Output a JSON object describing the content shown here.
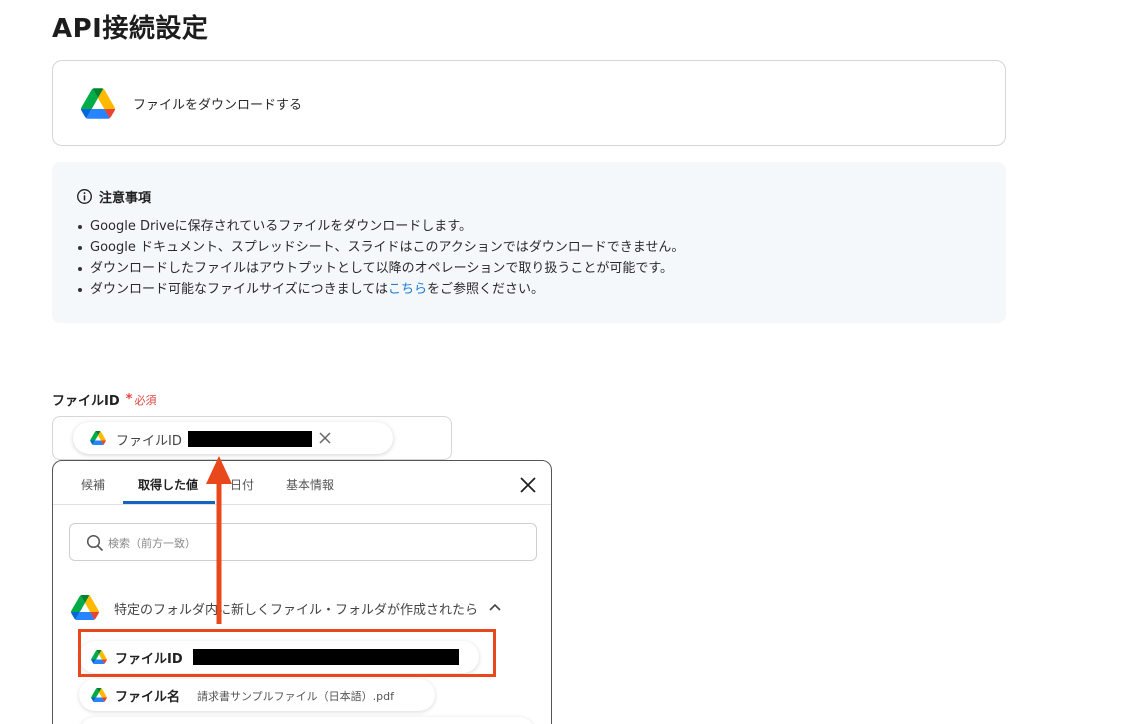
{
  "page_title": "API接続設定",
  "action": {
    "label": "ファイルをダウンロードする",
    "icon": "google-drive-icon"
  },
  "notice": {
    "title": "注意事項",
    "items": [
      "Google Driveに保存されているファイルをダウンロードします。",
      "Google ドキュメント、スプレッドシート、スライドはこのアクションではダウンロードできません。",
      "ダウンロードしたファイルはアウトプットとして以降のオペレーションで取り扱うことが可能です。"
    ],
    "last_item": {
      "before": "ダウンロード可能なファイルサイズにつきましては",
      "link": "こちら",
      "after": "をご参照ください。"
    }
  },
  "field": {
    "label": "ファイルID",
    "asterisk": "*",
    "required": "必須",
    "chip_label": "ファイルID"
  },
  "popover": {
    "tabs": [
      "候補",
      "取得した値",
      "日付",
      "基本情報"
    ],
    "active_tab": "取得した値",
    "search_placeholder": "検索（前方一致）",
    "group_label": "特定のフォルダ内に新しくファイル・フォルダが作成されたら",
    "outputs": [
      {
        "key": "ファイルID",
        "value": ""
      },
      {
        "key": "ファイル名",
        "value": "請求書サンプルファイル（日本語）.pdf"
      }
    ]
  },
  "colors": {
    "accent_blue": "#1565c0",
    "highlight": "#e8481c",
    "required_red": "#e2463e",
    "notice_bg": "#f5f8fb"
  }
}
